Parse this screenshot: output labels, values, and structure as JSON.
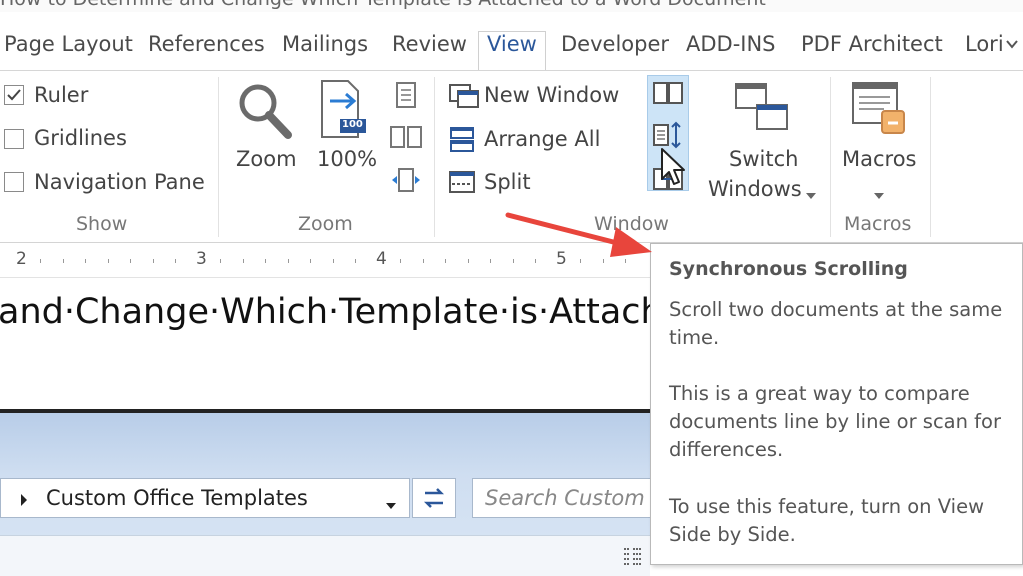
{
  "window": {
    "title": "How to Determine and Change Which Template is Attached to a Word Document"
  },
  "tabs": [
    {
      "label": "Page Layout"
    },
    {
      "label": "References"
    },
    {
      "label": "Mailings"
    },
    {
      "label": "Review"
    },
    {
      "label": "View",
      "active": true
    },
    {
      "label": "Developer"
    },
    {
      "label": "ADD-INS"
    },
    {
      "label": "PDF Architect"
    }
  ],
  "user": {
    "name": "Lori"
  },
  "ribbon": {
    "show": {
      "label": "Show",
      "items": [
        {
          "label": "Ruler",
          "checked": true
        },
        {
          "label": "Gridlines",
          "checked": false
        },
        {
          "label": "Navigation Pane",
          "checked": false
        }
      ]
    },
    "zoom": {
      "label": "Zoom",
      "zoom_label": "Zoom",
      "hundred_label": "100%",
      "badge": "100"
    },
    "window": {
      "label": "Window",
      "new_window": "New Window",
      "arrange_all": "Arrange All",
      "split": "Split",
      "switch_windows_line1": "Switch",
      "switch_windows_line2": "Windows"
    },
    "macros": {
      "label": "Macros",
      "macros_label": "Macros"
    }
  },
  "ruler": {
    "numbers": [
      "2",
      "3",
      "4",
      "5"
    ]
  },
  "document": {
    "heading": "and·Change·Which·Template·is·Attach"
  },
  "dialog": {
    "address": "Custom Office Templates",
    "search_placeholder": "Search Custom O"
  },
  "tooltip": {
    "title": "Synchronous Scrolling",
    "p1": "Scroll two documents at the same time.",
    "p2": "This is a great way to compare documents line by line or scan for differences.",
    "p3": "To use this feature, turn on View Side by Side."
  },
  "colors": {
    "accent": "#2b579a",
    "annotation_arrow": "#e8453c",
    "hover": "#cde4f7"
  }
}
